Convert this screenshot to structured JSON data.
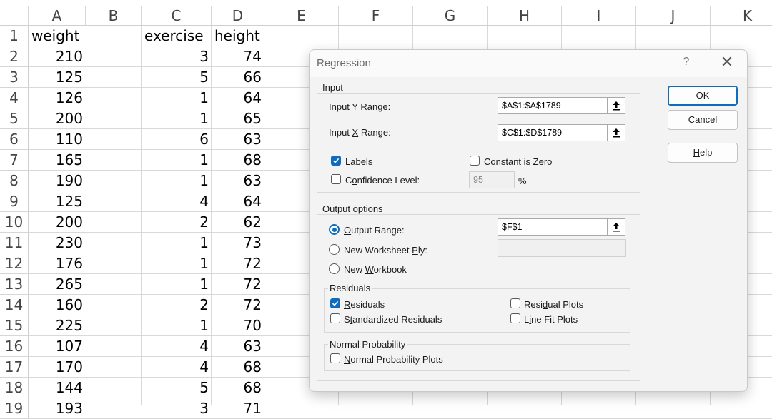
{
  "spreadsheet": {
    "columns": [
      "A",
      "B",
      "C",
      "D",
      "E",
      "F",
      "G",
      "H",
      "I",
      "J",
      "K"
    ],
    "rows": [
      "1",
      "2",
      "3",
      "4",
      "5",
      "6",
      "7",
      "8",
      "9",
      "10",
      "11",
      "12",
      "13",
      "14",
      "15",
      "16",
      "17",
      "18",
      "19"
    ],
    "headers": {
      "A": "weight",
      "C": "exercise",
      "D": "height"
    },
    "weight": [
      "210",
      "125",
      "126",
      "200",
      "110",
      "165",
      "190",
      "125",
      "200",
      "230",
      "176",
      "265",
      "160",
      "225",
      "107",
      "170",
      "144",
      "193"
    ],
    "exercise": [
      "3",
      "5",
      "1",
      "1",
      "6",
      "1",
      "1",
      "4",
      "2",
      "1",
      "1",
      "1",
      "2",
      "1",
      "4",
      "4",
      "5",
      "3"
    ],
    "height": [
      "74",
      "66",
      "64",
      "65",
      "63",
      "68",
      "63",
      "64",
      "62",
      "73",
      "72",
      "72",
      "72",
      "70",
      "63",
      "68",
      "68",
      "71"
    ]
  },
  "dialog": {
    "title": "Regression",
    "help_glyph": "?",
    "close_glyph": "✕",
    "input": {
      "group_label": "Input",
      "y_range_label": {
        "pre": "Input ",
        "key": "Y",
        "post": " Range:"
      },
      "y_range_value": "$A$1:$A$1789",
      "x_range_label": {
        "pre": "Input ",
        "key": "X",
        "post": " Range:"
      },
      "x_range_value": "$C$1:$D$1789",
      "labels": {
        "pre": "",
        "key": "L",
        "post": "abels",
        "checked": true
      },
      "constant_zero": {
        "pre": "Constant is ",
        "key": "Z",
        "post": "ero",
        "checked": false
      },
      "confidence": {
        "pre": "C",
        "key": "o",
        "post": "nfidence Level:",
        "checked": false
      },
      "confidence_value": "95",
      "percent": "%"
    },
    "output": {
      "group_label": "Output options",
      "output_range": {
        "pre": "",
        "key": "O",
        "post": "utput Range:",
        "selected": true
      },
      "output_range_value": "$F$1",
      "new_ply": {
        "pre": "New Worksheet ",
        "key": "P",
        "post": "ly:",
        "selected": false
      },
      "new_workbook": {
        "pre": "New ",
        "key": "W",
        "post": "orkbook",
        "selected": false
      }
    },
    "residuals": {
      "group_label": "Residuals",
      "residuals": {
        "pre": "",
        "key": "R",
        "post": "esiduals",
        "checked": true
      },
      "standardized": {
        "pre": "S",
        "key": "t",
        "post": "andardized Residuals",
        "checked": false
      },
      "residual_plots": {
        "pre": "Resi",
        "key": "d",
        "post": "ual Plots",
        "checked": false
      },
      "line_fit": {
        "pre": "L",
        "key": "i",
        "post": "ne Fit Plots",
        "checked": false
      }
    },
    "normal": {
      "group_label": "Normal Probability",
      "plots": {
        "pre": "",
        "key": "N",
        "post": "ormal Probability Plots",
        "checked": false
      }
    },
    "buttons": {
      "ok": "OK",
      "cancel": "Cancel",
      "help": {
        "pre": "",
        "key": "H",
        "post": "elp"
      }
    }
  }
}
